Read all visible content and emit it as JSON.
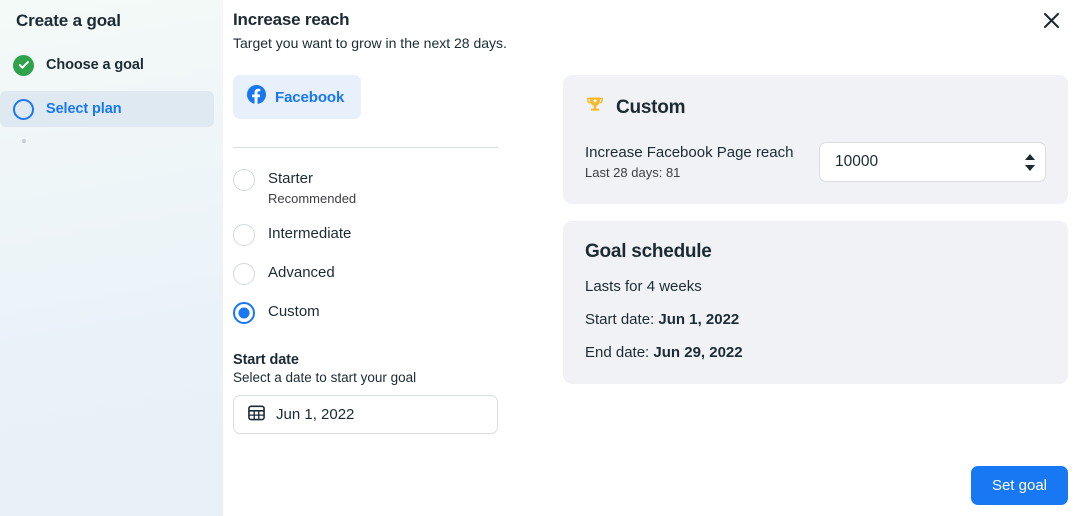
{
  "sidebar": {
    "title": "Create a goal",
    "steps": [
      {
        "label": "Choose a goal",
        "state": "completed",
        "icon": "check-circle-icon"
      },
      {
        "label": "Select plan",
        "state": "active",
        "icon": "circle-outline-icon"
      }
    ]
  },
  "header": {
    "title": "Increase reach",
    "subtitle": "Target you want to grow in the next 28 days.",
    "close_icon": "close-icon"
  },
  "platform_tabs": [
    {
      "label": "Facebook",
      "icon": "facebook-icon",
      "selected": true
    }
  ],
  "plans": {
    "options": [
      {
        "label": "Starter",
        "sub": "Recommended",
        "selected": false
      },
      {
        "label": "Intermediate",
        "sub": "",
        "selected": false
      },
      {
        "label": "Advanced",
        "sub": "",
        "selected": false
      },
      {
        "label": "Custom",
        "sub": "",
        "selected": true
      }
    ]
  },
  "start_date": {
    "heading": "Start date",
    "description": "Select a date to start your goal",
    "icon": "calendar-icon",
    "value": "Jun 1, 2022"
  },
  "custom_card": {
    "icon": "trophy-icon",
    "title": "Custom",
    "metric_name": "Increase Facebook Page reach",
    "metric_sub": "Last 28 days: 81",
    "target_value": "10000",
    "stepper_up_icon": "triangle-up-icon",
    "stepper_down_icon": "triangle-down-icon"
  },
  "goal_schedule": {
    "title": "Goal schedule",
    "duration": "Lasts for 4 weeks",
    "start_label": "Start date:",
    "start_value": "Jun 1, 2022",
    "end_label": "End date:",
    "end_value": "Jun 29, 2022"
  },
  "footer": {
    "primary_label": "Set goal"
  },
  "colors": {
    "accent_blue": "#1877f2",
    "success_green": "#31a24c",
    "trophy_gold": "#f7b928",
    "card_bg": "#f1f2f5",
    "text_dark": "#1c2b33"
  }
}
